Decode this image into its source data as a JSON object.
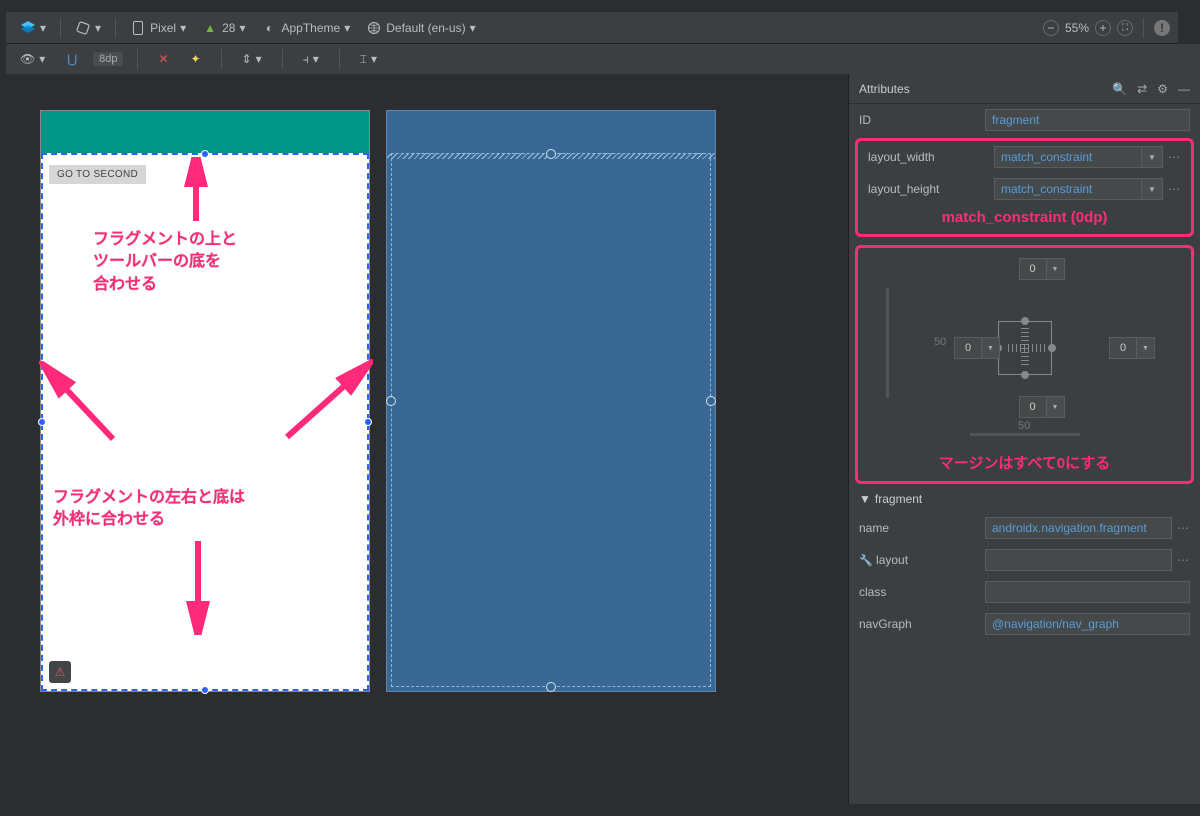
{
  "toolbar": {
    "device": "Pixel",
    "api": "28",
    "theme": "AppTheme",
    "locale": "Default (en-us)",
    "zoom": "55%"
  },
  "secondbar": {
    "margin_default": "8dp"
  },
  "design": {
    "button_label": "GO TO SECOND"
  },
  "annotations": {
    "top_line1": "フラグメントの上と",
    "top_line2": "ツールバーの底を",
    "top_line3": "合わせる",
    "bottom_line1": "フラグメントの左右と底は",
    "bottom_line2": "外枠に合わせる",
    "match_caption": "match_constraint (0dp)",
    "margin_caption": "マージンはすべて0にする"
  },
  "attributes": {
    "title": "Attributes",
    "id_label": "ID",
    "id_value": "fragment",
    "width_label": "layout_width",
    "width_value": "match_constraint",
    "height_label": "layout_height",
    "height_value": "match_constraint",
    "margins": {
      "top": "0",
      "left": "0",
      "right": "0",
      "bottom": "0"
    },
    "bias_h": "50",
    "bias_v": "50",
    "section": "fragment",
    "name_label": "name",
    "name_value": "androidx.navigation.fragment",
    "layout_label": "layout",
    "class_label": "class",
    "navgraph_label": "navGraph",
    "navgraph_value": "@navigation/nav_graph"
  }
}
